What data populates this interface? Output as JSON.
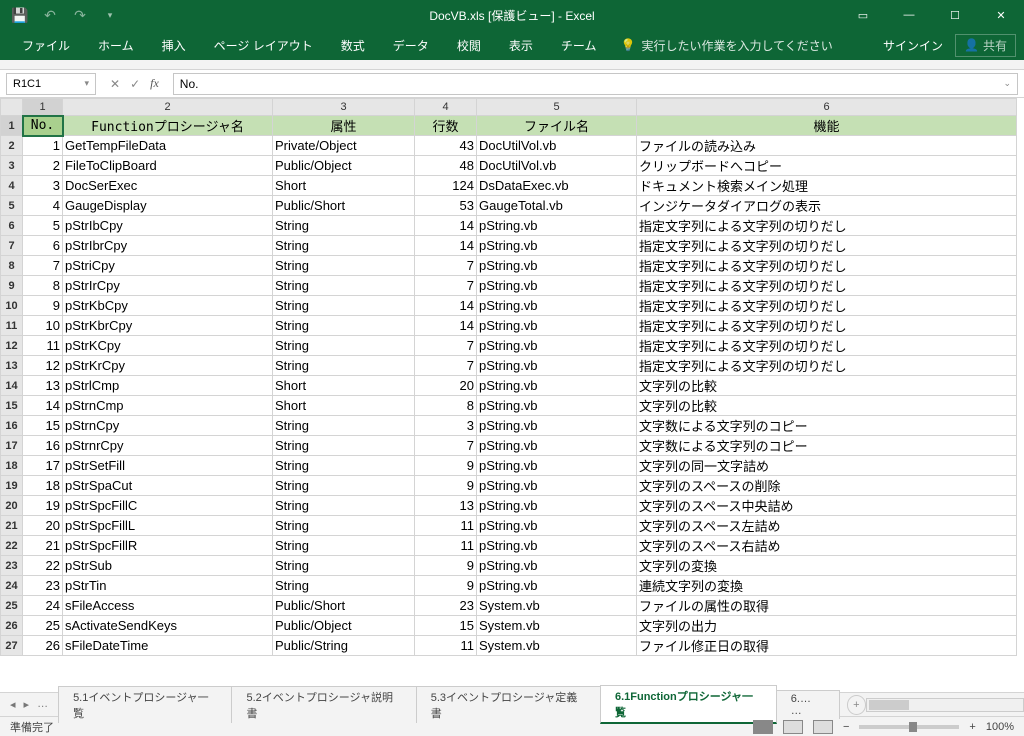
{
  "title": "DocVB.xls  [保護ビュー] - Excel",
  "ribbon": {
    "file": "ファイル",
    "home": "ホーム",
    "insert": "挿入",
    "pagelayout": "ページ レイアウト",
    "formulas": "数式",
    "data": "データ",
    "review": "校閲",
    "view": "表示",
    "team": "チーム",
    "tellme": "実行したい作業を入力してください",
    "signin": "サインイン",
    "share": "共有"
  },
  "namebox": "R1C1",
  "formula": "No.",
  "colhdrs": [
    "1",
    "2",
    "3",
    "4",
    "5",
    "6"
  ],
  "headers": {
    "no": "No.",
    "fn": "Functionプロシージャ名",
    "attr": "属性",
    "lines": "行数",
    "file": "ファイル名",
    "feat": "機能"
  },
  "rows": [
    {
      "n": "1",
      "fn": "GetTempFileData",
      "attr": "Private/Object",
      "l": "43",
      "f": "DocUtilVol.vb",
      "d": "ファイルの読み込み"
    },
    {
      "n": "2",
      "fn": "FileToClipBoard",
      "attr": "Public/Object",
      "l": "48",
      "f": "DocUtilVol.vb",
      "d": "クリップボードへコピー"
    },
    {
      "n": "3",
      "fn": "DocSerExec",
      "attr": "Short",
      "l": "124",
      "f": "DsDataExec.vb",
      "d": "ドキュメント検索メイン処理"
    },
    {
      "n": "4",
      "fn": "GaugeDisplay",
      "attr": "Public/Short",
      "l": "53",
      "f": "GaugeTotal.vb",
      "d": "インジケータダイアログの表示"
    },
    {
      "n": "5",
      "fn": "pStrIbCpy",
      "attr": "String",
      "l": "14",
      "f": "pString.vb",
      "d": "指定文字列による文字列の切りだし"
    },
    {
      "n": "6",
      "fn": "pStrIbrCpy",
      "attr": "String",
      "l": "14",
      "f": "pString.vb",
      "d": "指定文字列による文字列の切りだし"
    },
    {
      "n": "7",
      "fn": "pStriCpy",
      "attr": "String",
      "l": "7",
      "f": "pString.vb",
      "d": "指定文字列による文字列の切りだし"
    },
    {
      "n": "8",
      "fn": "pStrIrCpy",
      "attr": "String",
      "l": "7",
      "f": "pString.vb",
      "d": "指定文字列による文字列の切りだし"
    },
    {
      "n": "9",
      "fn": "pStrKbCpy",
      "attr": "String",
      "l": "14",
      "f": "pString.vb",
      "d": "指定文字列による文字列の切りだし"
    },
    {
      "n": "10",
      "fn": "pStrKbrCpy",
      "attr": "String",
      "l": "14",
      "f": "pString.vb",
      "d": "指定文字列による文字列の切りだし"
    },
    {
      "n": "11",
      "fn": "pStrKCpy",
      "attr": "String",
      "l": "7",
      "f": "pString.vb",
      "d": "指定文字列による文字列の切りだし"
    },
    {
      "n": "12",
      "fn": "pStrKrCpy",
      "attr": "String",
      "l": "7",
      "f": "pString.vb",
      "d": "指定文字列による文字列の切りだし"
    },
    {
      "n": "13",
      "fn": "pStrlCmp",
      "attr": "Short",
      "l": "20",
      "f": "pString.vb",
      "d": "文字列の比較"
    },
    {
      "n": "14",
      "fn": "pStrnCmp",
      "attr": "Short",
      "l": "8",
      "f": "pString.vb",
      "d": "文字列の比較"
    },
    {
      "n": "15",
      "fn": "pStrnCpy",
      "attr": "String",
      "l": "3",
      "f": "pString.vb",
      "d": "文字数による文字列のコピー"
    },
    {
      "n": "16",
      "fn": "pStrnrCpy",
      "attr": "String",
      "l": "7",
      "f": "pString.vb",
      "d": "文字数による文字列のコピー"
    },
    {
      "n": "17",
      "fn": "pStrSetFill",
      "attr": "String",
      "l": "9",
      "f": "pString.vb",
      "d": "文字列の同一文字詰め"
    },
    {
      "n": "18",
      "fn": "pStrSpaCut",
      "attr": "String",
      "l": "9",
      "f": "pString.vb",
      "d": "文字列のスペースの削除"
    },
    {
      "n": "19",
      "fn": "pStrSpcFillC",
      "attr": "String",
      "l": "13",
      "f": "pString.vb",
      "d": "文字列のスペース中央詰め"
    },
    {
      "n": "20",
      "fn": "pStrSpcFillL",
      "attr": "String",
      "l": "11",
      "f": "pString.vb",
      "d": "文字列のスペース左詰め"
    },
    {
      "n": "21",
      "fn": "pStrSpcFillR",
      "attr": "String",
      "l": "11",
      "f": "pString.vb",
      "d": "文字列のスペース右詰め"
    },
    {
      "n": "22",
      "fn": "pStrSub",
      "attr": "String",
      "l": "9",
      "f": "pString.vb",
      "d": "文字列の変換"
    },
    {
      "n": "23",
      "fn": "pStrTin",
      "attr": "String",
      "l": "9",
      "f": "pString.vb",
      "d": "連続文字列の変換"
    },
    {
      "n": "24",
      "fn": "sFileAccess",
      "attr": "Public/Short",
      "l": "23",
      "f": "System.vb",
      "d": "ファイルの属性の取得"
    },
    {
      "n": "25",
      "fn": "sActivateSendKeys",
      "attr": "Public/Object",
      "l": "15",
      "f": "System.vb",
      "d": "文字列の出力"
    },
    {
      "n": "26",
      "fn": "sFileDateTime",
      "attr": "Public/String",
      "l": "11",
      "f": "System.vb",
      "d": "ファイル修正日の取得"
    }
  ],
  "tabs": {
    "more": "…",
    "t1": "5.1イベントプロシージャ一覧",
    "t2": "5.2イベントプロシージャ説明書",
    "t3": "5.3イベントプロシージャ定義書",
    "t4": "6.1Functionプロシージャ一覧",
    "t5": "6.… …"
  },
  "status": "準備完了",
  "zoom": "100%"
}
